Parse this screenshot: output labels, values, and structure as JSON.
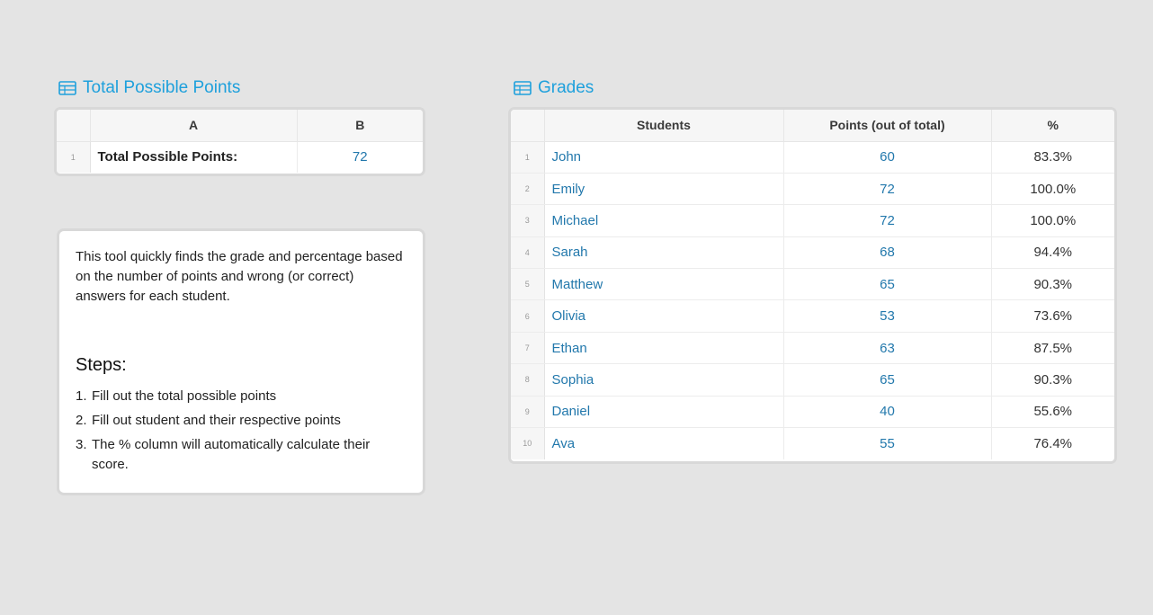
{
  "total_block": {
    "title": "Total Possible Points",
    "columns": [
      "A",
      "B"
    ],
    "rows": [
      {
        "num": "1",
        "label": "Total Possible Points:",
        "value": "72"
      }
    ]
  },
  "grades_block": {
    "title": "Grades",
    "columns": [
      "Students",
      "Points (out of total)",
      "%"
    ],
    "rows": [
      {
        "num": "1",
        "student": "John",
        "points": "60",
        "pct": "83.3%"
      },
      {
        "num": "2",
        "student": "Emily",
        "points": "72",
        "pct": "100.0%"
      },
      {
        "num": "3",
        "student": "Michael",
        "points": "72",
        "pct": "100.0%"
      },
      {
        "num": "4",
        "student": "Sarah",
        "points": "68",
        "pct": "94.4%"
      },
      {
        "num": "5",
        "student": "Matthew",
        "points": "65",
        "pct": "90.3%"
      },
      {
        "num": "6",
        "student": "Olivia",
        "points": "53",
        "pct": "73.6%"
      },
      {
        "num": "7",
        "student": "Ethan",
        "points": "63",
        "pct": "87.5%"
      },
      {
        "num": "8",
        "student": "Sophia",
        "points": "65",
        "pct": "90.3%"
      },
      {
        "num": "9",
        "student": "Daniel",
        "points": "40",
        "pct": "55.6%"
      },
      {
        "num": "10",
        "student": "Ava",
        "points": "55",
        "pct": "76.4%"
      }
    ]
  },
  "instructions": {
    "intro": "This tool quickly finds the grade and percentage based on the number of points and wrong (or correct) answers for each student.",
    "steps_title": "Steps:",
    "steps": [
      {
        "n": "1.",
        "text": "Fill out the total possible points"
      },
      {
        "n": "2.",
        "text": "Fill out student and their respective points"
      },
      {
        "n": "3.",
        "text": "The % column will automatically calculate their score."
      }
    ]
  },
  "colors": {
    "accent": "#1ea0dc",
    "link": "#2278ac",
    "background": "#e4e4e4"
  },
  "icons": {
    "table_block": "table-icon"
  }
}
